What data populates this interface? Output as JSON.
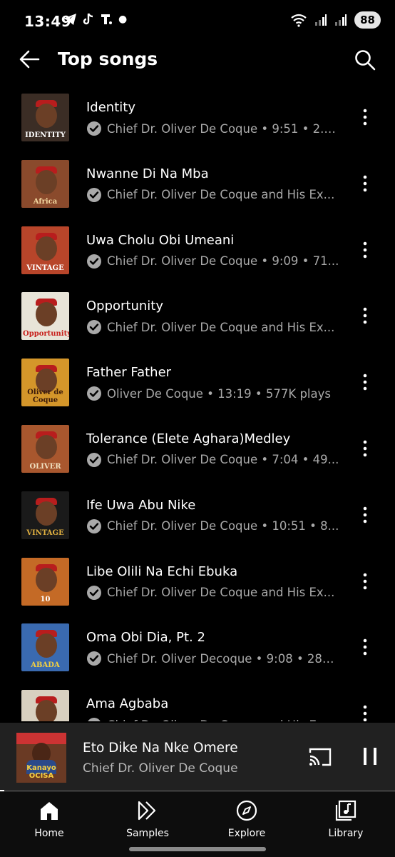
{
  "status_bar": {
    "time": "13:49",
    "battery": "88"
  },
  "header": {
    "title": "Top songs"
  },
  "songs": [
    {
      "title": "Identity",
      "meta": "Chief Dr. Oliver De Coque • 9:51 • 2.6...",
      "art_text": "IDENTITY",
      "art_bg": "#3b2d25",
      "art_fg": "#ffffff"
    },
    {
      "title": "Nwanne Di Na Mba",
      "meta": "Chief Dr. Oliver De Coque and His Ex...",
      "art_text": "Africa",
      "art_bg": "#8a4a2c",
      "art_fg": "#f4d8a0"
    },
    {
      "title": "Uwa Cholu Obi Umeani",
      "meta": "Chief Dr. Oliver De Coque • 9:09 • 71...",
      "art_text": "VINTAGE",
      "art_bg": "#b8452a",
      "art_fg": "#ffffff"
    },
    {
      "title": "Opportunity",
      "meta": "Chief Dr. Oliver De Coque and His Ex...",
      "art_text": "Opportunity",
      "art_bg": "#e8e4d8",
      "art_fg": "#c8201c"
    },
    {
      "title": "Father Father",
      "meta": "Oliver De Coque • 13:19 • 577K plays",
      "art_text": "Oliver de Coque",
      "art_bg": "#d4962a",
      "art_fg": "#3a1a0a"
    },
    {
      "title": "Tolerance (Elete Aghara)Medley",
      "meta": "Chief Dr. Oliver De Coque • 7:04 • 49...",
      "art_text": "OLIVER",
      "art_bg": "#a8572e",
      "art_fg": "#f0e0c0"
    },
    {
      "title": "Ife Uwa Abu Nike",
      "meta": "Chief Dr. Oliver De Coque • 10:51 • 8...",
      "art_text": "VINTAGE",
      "art_bg": "#1a1a1a",
      "art_fg": "#e0b040"
    },
    {
      "title": "Libe Olili Na Echi Ebuka",
      "meta": "Chief Dr. Oliver De Coque and His Ex...",
      "art_text": "10",
      "art_bg": "#c46a26",
      "art_fg": "#ffffff"
    },
    {
      "title": "Oma Obi Dia, Pt. 2",
      "meta": "Chief Dr. Oliver Decoque • 9:08 • 286...",
      "art_text": "ABADA",
      "art_bg": "#3a6ab0",
      "art_fg": "#f4d040"
    },
    {
      "title": "Ama Agbaba",
      "meta": "Chief Dr. Oliver De Coque and His Ex...",
      "art_text": "",
      "art_bg": "#d8d0c0",
      "art_fg": "#c8201c"
    }
  ],
  "now_playing": {
    "title": "Eto Dike Na Nke Omere",
    "artist": "Chief Dr. Oliver De Coque",
    "art_text": "Kanayo OCISA",
    "progress_fraction": 0.01
  },
  "nav": [
    {
      "label": "Home",
      "icon": "home-icon"
    },
    {
      "label": "Samples",
      "icon": "samples-icon"
    },
    {
      "label": "Explore",
      "icon": "compass-icon"
    },
    {
      "label": "Library",
      "icon": "library-icon"
    }
  ]
}
